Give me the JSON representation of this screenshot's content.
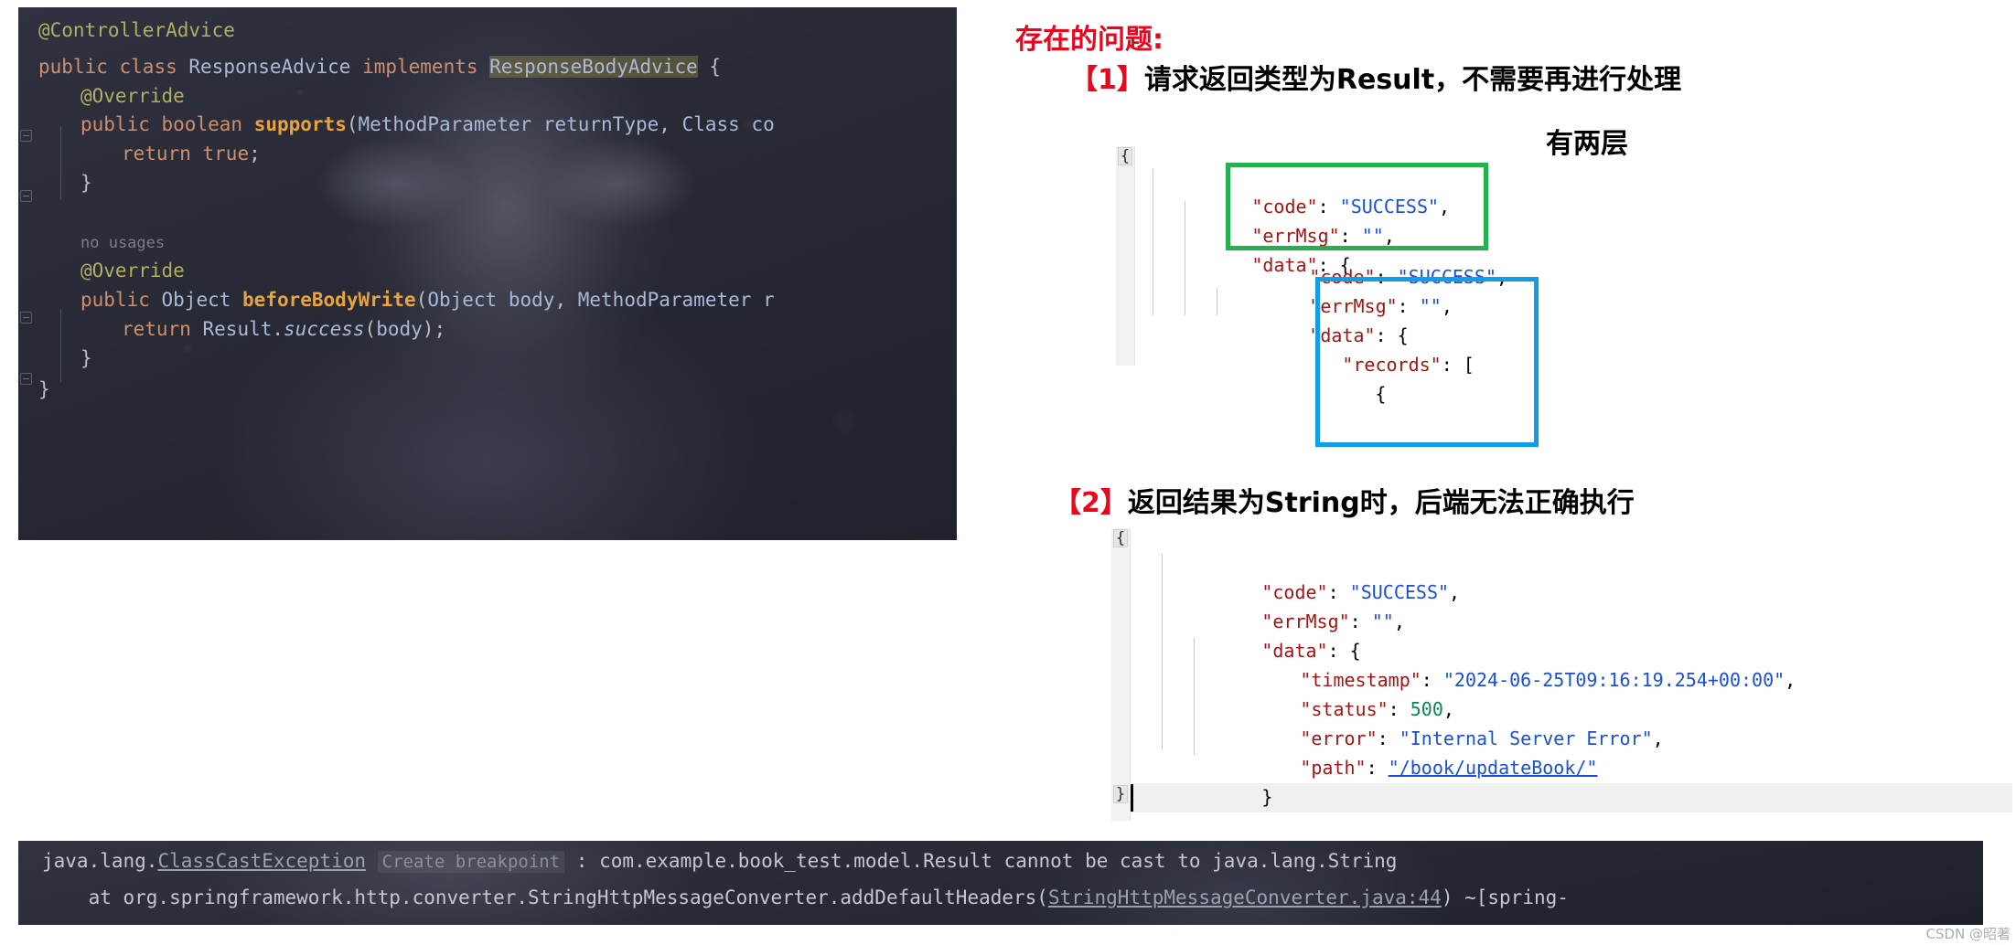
{
  "editor": {
    "name": "java-code-editor",
    "language": "java",
    "lines": [
      "@ControllerAdvice",
      "public class ResponseAdvice implements ResponseBodyAdvice {",
      "    @Override",
      "    public boolean supports(MethodParameter returnType, Class co",
      "        return true;",
      "    }",
      "",
      "    no usages",
      "    @Override",
      "    public Object beforeBodyWrite(Object body, MethodParameter r",
      "        return Result.success(body);",
      "    }",
      "}"
    ],
    "tokens": {
      "annotation_controller_advice": "@ControllerAdvice",
      "kw_public": "public",
      "kw_class": "class",
      "type_response_advice": "ResponseAdvice",
      "kw_implements": "implements",
      "type_response_body_advice": "ResponseBodyAdvice",
      "brace_open": "{",
      "annotation_override": "@Override",
      "kw_boolean": "boolean",
      "method_supports": "supports",
      "param_method_parameter": "MethodParameter",
      "param_return_type": "returnType",
      "param_class": "Class",
      "param_co_truncated": "co",
      "kw_return": "return",
      "kw_true": "true",
      "semicolon": ";",
      "brace_close": "}",
      "hint_no_usages": "no usages",
      "type_object": "Object",
      "method_before_body_write": "beforeBodyWrite",
      "param_body": "body",
      "param_r_truncated": "r",
      "type_result": "Result",
      "method_success": "success",
      "paren_open": "(",
      "paren_close": ")",
      "comma": ",",
      "dot": "."
    }
  },
  "console": {
    "name": "stacktrace-console",
    "line1": {
      "prefix": "java.lang.",
      "link": "ClassCastException",
      "breakpoint_hint": "Create breakpoint",
      "rest": " : com.example.book_test.model.Result cannot be cast to java.lang.String"
    },
    "line2": {
      "prefix": "    at org.springframework.http.converter.StringHttpMessageConverter.addDefaultHeaders(",
      "link": "StringHttpMessageConverter.java:44",
      "rest": ") ~[spring-"
    }
  },
  "right": {
    "heading": "存在的问题:",
    "item1": {
      "num": "【1】",
      "text": "请求返回类型为Result，不需要再进行处理"
    },
    "item2": {
      "num": "【2】",
      "text": "返回结果为String时，后端无法正确执行"
    },
    "annotation_two_layers": "有两层",
    "colors": {
      "red": "#e8071e",
      "green_box": "#22b14c",
      "blue_box": "#0f9ee8",
      "json_key": "#a31515",
      "json_string": "#1a4fd6",
      "json_number": "#098658"
    }
  },
  "json_block_1": {
    "name": "nested-result-json",
    "fold_marker_top": "{",
    "outer_lines": [
      {
        "indent": 0,
        "key": "\"code\"",
        "sep": ": ",
        "value": "\"SUCCESS\"",
        "type": "string",
        "trail": ","
      },
      {
        "indent": 0,
        "key": "\"errMsg\"",
        "sep": ": ",
        "value": "\"\"",
        "type": "string",
        "trail": ","
      },
      {
        "indent": 0,
        "key": "\"data\"",
        "sep": ": ",
        "value": "{",
        "type": "punct",
        "trail": ""
      }
    ],
    "inner_lines": [
      {
        "indent": 0,
        "key": "\"code\"",
        "sep": ": ",
        "value": "\"SUCCESS\"",
        "type": "string",
        "trail": ","
      },
      {
        "indent": 0,
        "key": "\"errMsg\"",
        "sep": ": ",
        "value": "\"\"",
        "type": "string",
        "trail": ","
      },
      {
        "indent": 0,
        "key": "\"data\"",
        "sep": ": ",
        "value": "{",
        "type": "punct",
        "trail": ""
      },
      {
        "indent": 1,
        "key": "\"records\"",
        "sep": ": ",
        "value": "[",
        "type": "punct",
        "trail": ""
      },
      {
        "indent": 2,
        "key": "",
        "sep": "",
        "value": "{",
        "type": "punct",
        "trail": ""
      }
    ]
  },
  "json_block_2": {
    "name": "string-error-json",
    "fold_marker_top": "{",
    "fold_marker_bottom": "}",
    "lines": [
      {
        "indent": 0,
        "key": "\"code\"",
        "sep": ": ",
        "value": "\"SUCCESS\"",
        "type": "string",
        "trail": ","
      },
      {
        "indent": 0,
        "key": "\"errMsg\"",
        "sep": ": ",
        "value": "\"\"",
        "type": "string",
        "trail": ","
      },
      {
        "indent": 0,
        "key": "\"data\"",
        "sep": ": ",
        "value": "{",
        "type": "punct",
        "trail": ""
      },
      {
        "indent": 1,
        "key": "\"timestamp\"",
        "sep": ": ",
        "value": "\"2024-06-25T09:16:19.254+00:00\"",
        "type": "string",
        "trail": ","
      },
      {
        "indent": 1,
        "key": "\"status\"",
        "sep": ": ",
        "value": "500",
        "type": "number",
        "trail": ","
      },
      {
        "indent": 1,
        "key": "\"error\"",
        "sep": ": ",
        "value": "\"Internal Server Error\"",
        "type": "string",
        "trail": ","
      },
      {
        "indent": 1,
        "key": "\"path\"",
        "sep": ": ",
        "value": "\"/book/updateBook/\"",
        "type": "link",
        "trail": ""
      },
      {
        "indent": 0,
        "key": "",
        "sep": "",
        "value": "}",
        "type": "punct",
        "trail": ""
      }
    ]
  },
  "watermark": "CSDN @昭著"
}
